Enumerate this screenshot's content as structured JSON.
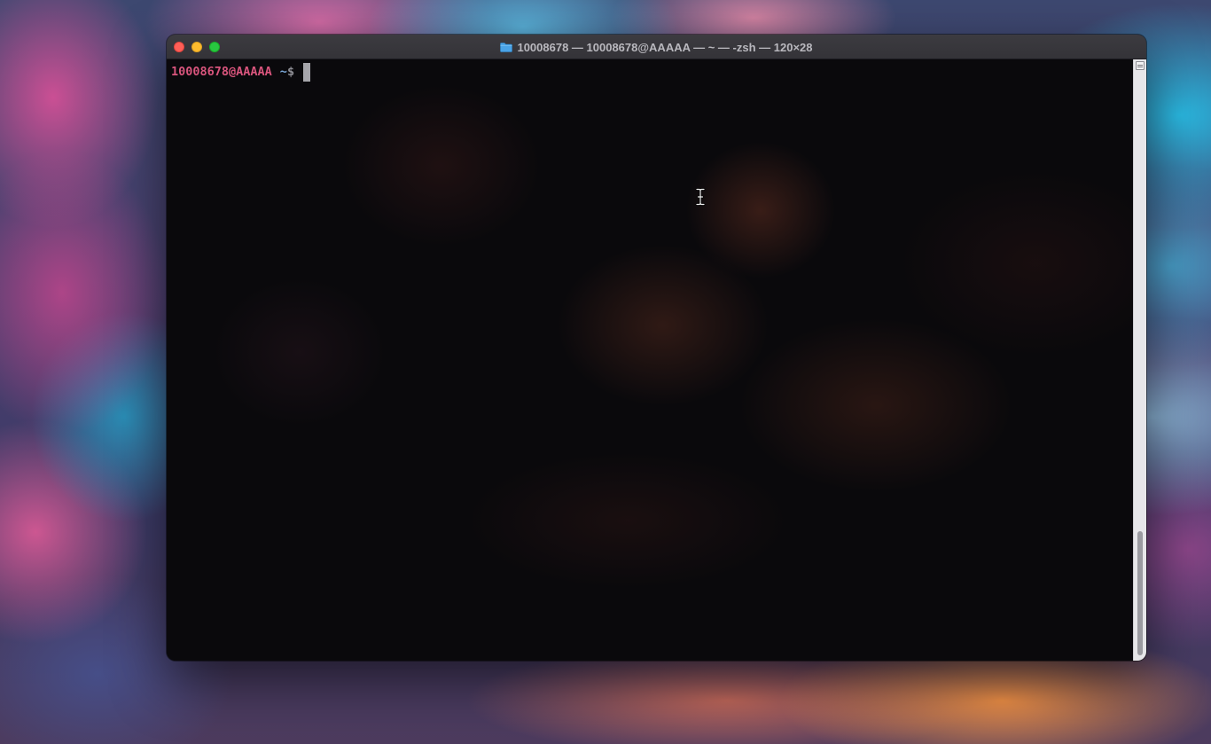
{
  "window": {
    "title": "10008678 — 10008678@AAAAA — ~ — -zsh — 120×28",
    "title_icon": "folder-icon",
    "buttons": [
      "close",
      "minimize",
      "zoom"
    ]
  },
  "terminal": {
    "prompt_user": "10008678@AAAAA",
    "prompt_dir": "~",
    "prompt_symbol": "$",
    "cursor": "block-cursor"
  },
  "scrollbar": {
    "position_fraction": 1.0
  },
  "colors": {
    "prompt_user": "#d9557d",
    "prompt_dir": "#7aa7d8",
    "close": "#ff5f57",
    "minimize": "#febc2e",
    "zoom": "#28c840",
    "folder": "#4aa3e6"
  }
}
